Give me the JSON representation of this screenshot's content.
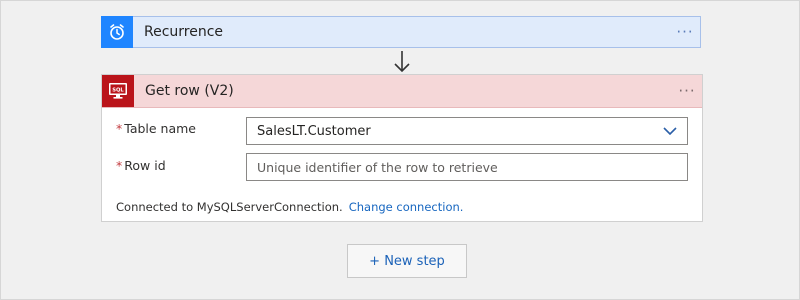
{
  "trigger": {
    "title": "Recurrence",
    "icon": "alarm-clock-icon",
    "accent": "#1f85ff",
    "more": "···"
  },
  "action": {
    "title": "Get row (V2)",
    "icon": "sql-server-icon",
    "icon_text": "SQL",
    "accent": "#ba141a",
    "more": "···",
    "fields": {
      "table_name": {
        "label": "Table name",
        "value": "SalesLT.Customer",
        "required_mark": "*"
      },
      "row_id": {
        "label": "Row id",
        "placeholder": "Unique identifier of the row to retrieve",
        "required_mark": "*"
      }
    },
    "connection": {
      "text": "Connected to MySQLServerConnection.",
      "change_label": "Change connection."
    }
  },
  "new_step": {
    "label": "+ New step"
  }
}
